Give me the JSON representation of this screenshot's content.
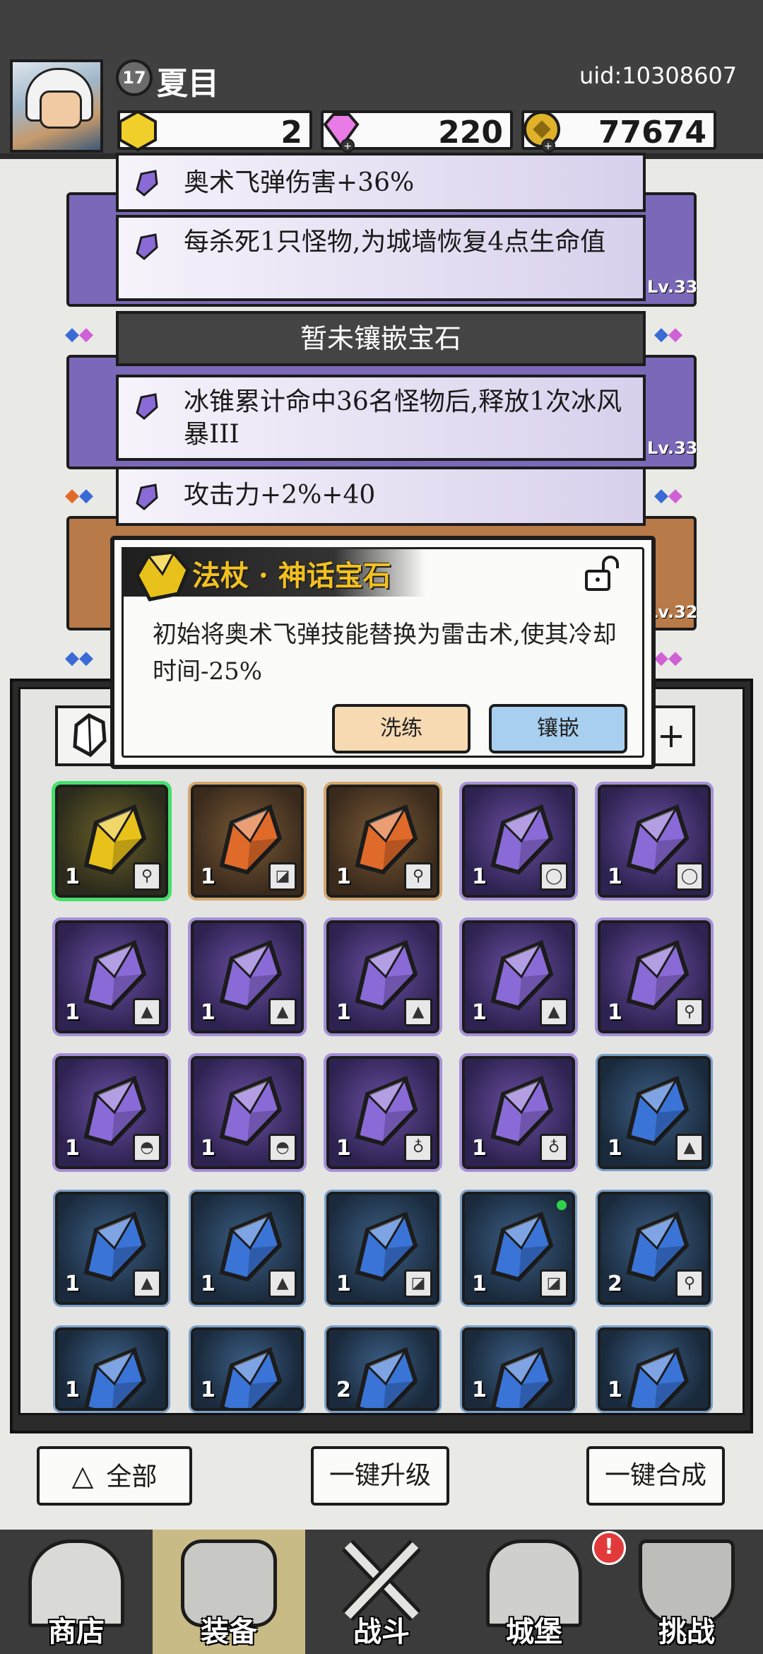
{
  "player": {
    "name": "夏目",
    "level": "17",
    "uid": "uid:10308607"
  },
  "resources": {
    "gold_gem": "2",
    "diamond": "220",
    "coin": "77674"
  },
  "equipment_levels": [
    "Lv.33",
    "Lv.33",
    "Lv.32"
  ],
  "gem_effects": [
    "奥术飞弹伤害+36%",
    "每杀死1只怪物,为城墙恢复4点生命值",
    "冰锥累计命中36名怪物后,释放1次冰风暴III",
    "攻击力+2%+40"
  ],
  "empty_slot_label": "暂未镶嵌宝石",
  "popup": {
    "title": "法杖 · 神话宝石",
    "description": "初始将奥术飞弹技能替换为雷击术,使其冷却时间-25%",
    "refine_label": "洗练",
    "inlay_label": "镶嵌"
  },
  "inventory": [
    {
      "rarity": "yellow",
      "count": "1",
      "slot": "staff",
      "selected": true
    },
    {
      "rarity": "orange",
      "count": "1",
      "slot": "boots"
    },
    {
      "rarity": "orange",
      "count": "1",
      "slot": "staff"
    },
    {
      "rarity": "purple",
      "count": "1",
      "slot": "ring"
    },
    {
      "rarity": "purple",
      "count": "1",
      "slot": "ring"
    },
    {
      "rarity": "purple",
      "count": "1",
      "slot": "armor"
    },
    {
      "rarity": "purple",
      "count": "1",
      "slot": "armor"
    },
    {
      "rarity": "purple",
      "count": "1",
      "slot": "armor"
    },
    {
      "rarity": "purple",
      "count": "1",
      "slot": "armor"
    },
    {
      "rarity": "purple",
      "count": "1",
      "slot": "staff"
    },
    {
      "rarity": "purple",
      "count": "1",
      "slot": "hat"
    },
    {
      "rarity": "purple",
      "count": "1",
      "slot": "hat"
    },
    {
      "rarity": "purple",
      "count": "1",
      "slot": "amulet"
    },
    {
      "rarity": "purple",
      "count": "1",
      "slot": "amulet"
    },
    {
      "rarity": "blue",
      "count": "1",
      "slot": "armor"
    },
    {
      "rarity": "blue",
      "count": "1",
      "slot": "armor"
    },
    {
      "rarity": "blue",
      "count": "1",
      "slot": "armor"
    },
    {
      "rarity": "blue",
      "count": "1",
      "slot": "boots"
    },
    {
      "rarity": "blue",
      "count": "1",
      "slot": "boots",
      "new": true
    },
    {
      "rarity": "blue",
      "count": "2",
      "slot": "staff"
    },
    {
      "rarity": "blue",
      "count": "1",
      "slot": ""
    },
    {
      "rarity": "blue",
      "count": "1",
      "slot": ""
    },
    {
      "rarity": "blue",
      "count": "2",
      "slot": ""
    },
    {
      "rarity": "blue",
      "count": "1",
      "slot": ""
    },
    {
      "rarity": "blue",
      "count": "1",
      "slot": ""
    }
  ],
  "actions": {
    "filter_all": "全部",
    "upgrade_all": "一键升级",
    "merge_all": "一键合成"
  },
  "nav": {
    "shop": "商店",
    "equipment": "装备",
    "battle": "战斗",
    "castle": "城堡",
    "challenge": "挑战",
    "castle_badge": "!"
  },
  "colors": {
    "yellow": "#e8c21a",
    "orange": "#e06a2a",
    "purple": "#8a6ad6",
    "blue": "#3a74d6",
    "accent_green": "#45e06a"
  }
}
